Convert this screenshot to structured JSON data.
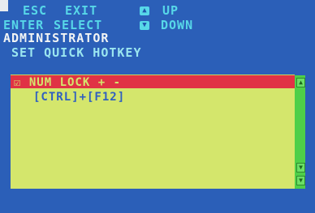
{
  "help": {
    "esc_key": "ESC",
    "esc_action": "EXIT",
    "up_label": "UP",
    "enter_key": "ENTER",
    "enter_action": "SELECT",
    "down_label": "DOWN",
    "up_icon": "arrow-up-icon",
    "down_icon": "arrow-down-icon"
  },
  "header": {
    "user": "ADMINISTRATOR",
    "title": "SET QUICK HOTKEY"
  },
  "menu": {
    "items": [
      {
        "label": "☑ NUM LOCK + -",
        "selected": true
      },
      {
        "label": "[CTRL]+[F12]",
        "selected": false
      }
    ]
  },
  "scrollbar": {
    "up_icon": "scroll-up-icon",
    "down_icon": "scroll-down-icon"
  },
  "colors": {
    "background": "#2b5fb8",
    "panel": "#d4e66c",
    "selection": "#e03245",
    "scrollbar": "#4ecf49",
    "help_text": "#57d7e8"
  }
}
